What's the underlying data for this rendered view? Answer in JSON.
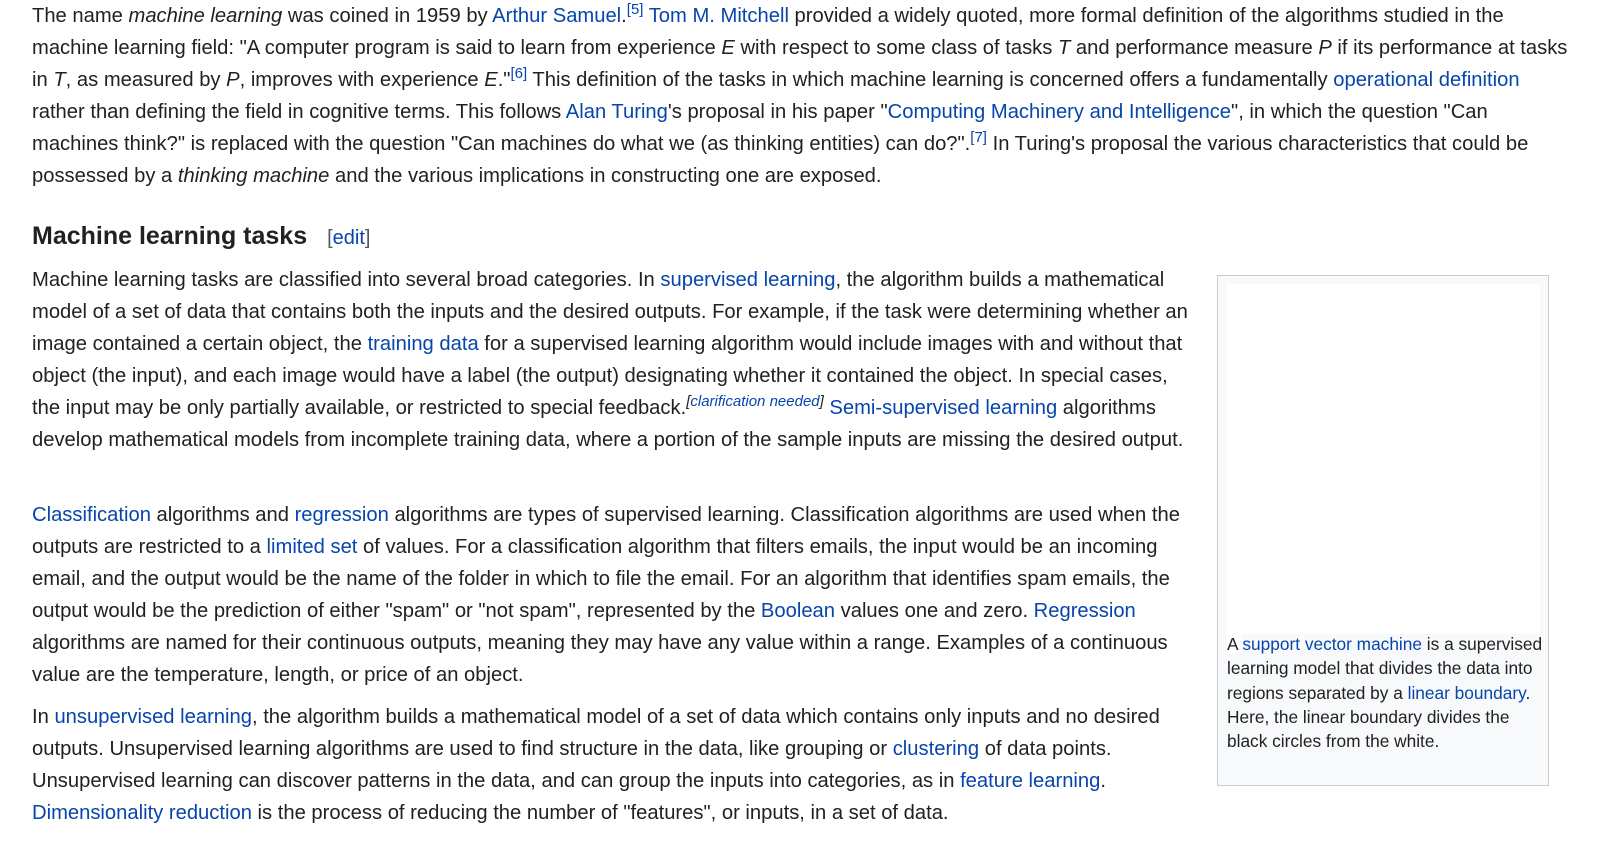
{
  "intro": {
    "t1": "The name ",
    "em1": "machine learning",
    "t2": " was coined in 1959 by ",
    "link_arthur": "Arthur Samuel",
    "t3": ".",
    "ref5": "[5]",
    "t4": " ",
    "link_mitchell": "Tom M. Mitchell",
    "t5": " provided a widely quoted, more formal definition of the algorithms studied in the machine learning field: \"A computer program is said to learn from experience ",
    "e": "E",
    "t6": " with respect to some class of tasks ",
    "tvar": "T",
    "t7": " and performance measure ",
    "p": "P",
    "t8": " if its performance at tasks in ",
    "tvar2": "T",
    "t9": ", as measured by ",
    "p2": "P",
    "t10": ", improves with experience ",
    "e2": "E",
    "t11": ".\"",
    "ref6": "[6]",
    "t12": " This definition of the tasks in which machine learning is concerned offers a fundamentally ",
    "link_operational": "operational definition",
    "t13": " rather than defining the field in cognitive terms. This follows ",
    "link_turing": "Alan Turing",
    "t14": "'s proposal in his paper \"",
    "link_cmi": "Computing Machinery and Intelligence",
    "t15": "\", in which the question \"Can machines think?\" is replaced with the question \"Can machines do what we (as thinking entities) can do?\".",
    "ref7": "[7]",
    "t16": " In Turing's proposal the various characteristics that could be possessed by a ",
    "em2": "thinking machine",
    "t17": " and the various implications in constructing one are exposed."
  },
  "section": {
    "title": "Machine learning tasks",
    "edit_open": "[",
    "edit_label": "edit",
    "edit_close": "]"
  },
  "para1": {
    "t1": "Machine learning tasks are classified into several broad categories. In ",
    "link_supervised": "supervised learning",
    "t2": ", the algorithm builds a mathematical model of a set of data that contains both the inputs and the desired outputs. For example, if the task were determining whether an image contained a certain object, the ",
    "link_training": "training data",
    "t3": " for a supervised learning algorithm would include images with and without that object (the input), and each image would have a label (the output) designating whether it contained the object. In special cases, the input may be only partially available, or restricted to special feedback.",
    "cn_open": "[",
    "cn_label": "clarification needed",
    "cn_close": "]",
    "t4": " ",
    "link_semi": "Semi-supervised learning",
    "t5": " algorithms develop mathematical models from incomplete training data, where a portion of the sample inputs are missing the desired output."
  },
  "para2": {
    "link_classification": "Classification",
    "t1": " algorithms and ",
    "link_regression": "regression",
    "t2": " algorithms are types of supervised learning. Classification algorithms are used when the outputs are restricted to a ",
    "link_limited": "limited set",
    "t3": " of values. For a classification algorithm that filters emails, the input would be an incoming email, and the output would be the name of the folder in which to file the email. For an algorithm that identifies spam emails, the output would be the prediction of either \"spam\" or \"not spam\", represented by the ",
    "link_boolean": "Boolean",
    "t4": " values one and zero. ",
    "link_regression2": "Regression",
    "t5": " algorithms are named for their continuous outputs, meaning they may have any value within a range. Examples of a continuous value are the temperature, length, or price of an object."
  },
  "para3": {
    "t1": "In ",
    "link_unsupervised": "unsupervised learning",
    "t2": ", the algorithm builds a mathematical model of a set of data which contains only inputs and no desired outputs. Unsupervised learning algorithms are used to find structure in the data, like grouping or ",
    "link_clustering": "clustering",
    "t3": " of data points. Unsupervised learning can discover patterns in the data, and can group the inputs into categories, as in ",
    "link_feature": "feature learning",
    "t4": ". ",
    "link_dim": "Dimensionality reduction",
    "t5": " is the process of reducing the number of \"features\", or inputs, in a set of data."
  },
  "thumb": {
    "t1": "A ",
    "link_svm": "support vector machine",
    "t2": " is a supervised learning model that divides the data into regions separated by a ",
    "link_linear": "linear boundary",
    "t3": ". Here, the linear boundary divides the black circles from the white."
  },
  "colors": {
    "text": "#202122",
    "link": "#0645ad",
    "thumb_border": "#c8ccd1",
    "thumb_bg": "#f8f9fa"
  }
}
